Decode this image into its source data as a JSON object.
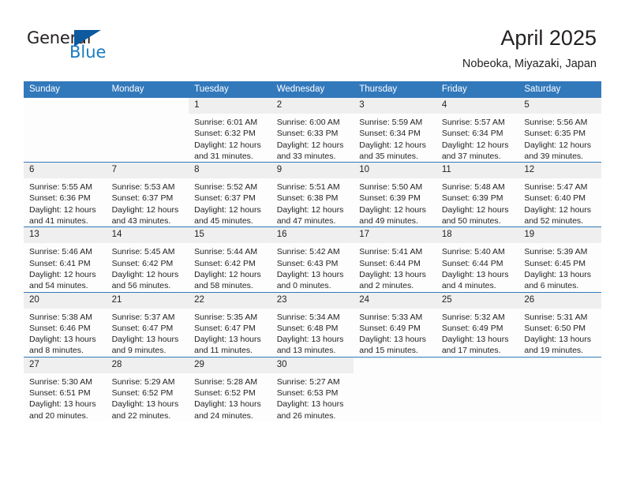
{
  "logo": {
    "word_one": "General",
    "word_two": "Blue",
    "triangle_icon": "triangle-icon"
  },
  "header": {
    "month_title": "April 2025",
    "location": "Nobeoka, Miyazaki, Japan"
  },
  "colors": {
    "header_blue": "#3279bc",
    "daynum_gray": "#efefef",
    "logo_blue": "#1a7bc0",
    "logo_triangle": "#0d5a9e",
    "text": "#231f20"
  },
  "calendar": {
    "weekday_headers": [
      "Sunday",
      "Monday",
      "Tuesday",
      "Wednesday",
      "Thursday",
      "Friday",
      "Saturday"
    ],
    "weeks": [
      [
        {
          "day": "",
          "empty": true
        },
        {
          "day": "",
          "empty": true
        },
        {
          "day": "1",
          "sunrise": "Sunrise: 6:01 AM",
          "sunset": "Sunset: 6:32 PM",
          "daylight": "Daylight: 12 hours and 31 minutes."
        },
        {
          "day": "2",
          "sunrise": "Sunrise: 6:00 AM",
          "sunset": "Sunset: 6:33 PM",
          "daylight": "Daylight: 12 hours and 33 minutes."
        },
        {
          "day": "3",
          "sunrise": "Sunrise: 5:59 AM",
          "sunset": "Sunset: 6:34 PM",
          "daylight": "Daylight: 12 hours and 35 minutes."
        },
        {
          "day": "4",
          "sunrise": "Sunrise: 5:57 AM",
          "sunset": "Sunset: 6:34 PM",
          "daylight": "Daylight: 12 hours and 37 minutes."
        },
        {
          "day": "5",
          "sunrise": "Sunrise: 5:56 AM",
          "sunset": "Sunset: 6:35 PM",
          "daylight": "Daylight: 12 hours and 39 minutes."
        }
      ],
      [
        {
          "day": "6",
          "sunrise": "Sunrise: 5:55 AM",
          "sunset": "Sunset: 6:36 PM",
          "daylight": "Daylight: 12 hours and 41 minutes."
        },
        {
          "day": "7",
          "sunrise": "Sunrise: 5:53 AM",
          "sunset": "Sunset: 6:37 PM",
          "daylight": "Daylight: 12 hours and 43 minutes."
        },
        {
          "day": "8",
          "sunrise": "Sunrise: 5:52 AM",
          "sunset": "Sunset: 6:37 PM",
          "daylight": "Daylight: 12 hours and 45 minutes."
        },
        {
          "day": "9",
          "sunrise": "Sunrise: 5:51 AM",
          "sunset": "Sunset: 6:38 PM",
          "daylight": "Daylight: 12 hours and 47 minutes."
        },
        {
          "day": "10",
          "sunrise": "Sunrise: 5:50 AM",
          "sunset": "Sunset: 6:39 PM",
          "daylight": "Daylight: 12 hours and 49 minutes."
        },
        {
          "day": "11",
          "sunrise": "Sunrise: 5:48 AM",
          "sunset": "Sunset: 6:39 PM",
          "daylight": "Daylight: 12 hours and 50 minutes."
        },
        {
          "day": "12",
          "sunrise": "Sunrise: 5:47 AM",
          "sunset": "Sunset: 6:40 PM",
          "daylight": "Daylight: 12 hours and 52 minutes."
        }
      ],
      [
        {
          "day": "13",
          "sunrise": "Sunrise: 5:46 AM",
          "sunset": "Sunset: 6:41 PM",
          "daylight": "Daylight: 12 hours and 54 minutes."
        },
        {
          "day": "14",
          "sunrise": "Sunrise: 5:45 AM",
          "sunset": "Sunset: 6:42 PM",
          "daylight": "Daylight: 12 hours and 56 minutes."
        },
        {
          "day": "15",
          "sunrise": "Sunrise: 5:44 AM",
          "sunset": "Sunset: 6:42 PM",
          "daylight": "Daylight: 12 hours and 58 minutes."
        },
        {
          "day": "16",
          "sunrise": "Sunrise: 5:42 AM",
          "sunset": "Sunset: 6:43 PM",
          "daylight": "Daylight: 13 hours and 0 minutes."
        },
        {
          "day": "17",
          "sunrise": "Sunrise: 5:41 AM",
          "sunset": "Sunset: 6:44 PM",
          "daylight": "Daylight: 13 hours and 2 minutes."
        },
        {
          "day": "18",
          "sunrise": "Sunrise: 5:40 AM",
          "sunset": "Sunset: 6:44 PM",
          "daylight": "Daylight: 13 hours and 4 minutes."
        },
        {
          "day": "19",
          "sunrise": "Sunrise: 5:39 AM",
          "sunset": "Sunset: 6:45 PM",
          "daylight": "Daylight: 13 hours and 6 minutes."
        }
      ],
      [
        {
          "day": "20",
          "sunrise": "Sunrise: 5:38 AM",
          "sunset": "Sunset: 6:46 PM",
          "daylight": "Daylight: 13 hours and 8 minutes."
        },
        {
          "day": "21",
          "sunrise": "Sunrise: 5:37 AM",
          "sunset": "Sunset: 6:47 PM",
          "daylight": "Daylight: 13 hours and 9 minutes."
        },
        {
          "day": "22",
          "sunrise": "Sunrise: 5:35 AM",
          "sunset": "Sunset: 6:47 PM",
          "daylight": "Daylight: 13 hours and 11 minutes."
        },
        {
          "day": "23",
          "sunrise": "Sunrise: 5:34 AM",
          "sunset": "Sunset: 6:48 PM",
          "daylight": "Daylight: 13 hours and 13 minutes."
        },
        {
          "day": "24",
          "sunrise": "Sunrise: 5:33 AM",
          "sunset": "Sunset: 6:49 PM",
          "daylight": "Daylight: 13 hours and 15 minutes."
        },
        {
          "day": "25",
          "sunrise": "Sunrise: 5:32 AM",
          "sunset": "Sunset: 6:49 PM",
          "daylight": "Daylight: 13 hours and 17 minutes."
        },
        {
          "day": "26",
          "sunrise": "Sunrise: 5:31 AM",
          "sunset": "Sunset: 6:50 PM",
          "daylight": "Daylight: 13 hours and 19 minutes."
        }
      ],
      [
        {
          "day": "27",
          "sunrise": "Sunrise: 5:30 AM",
          "sunset": "Sunset: 6:51 PM",
          "daylight": "Daylight: 13 hours and 20 minutes."
        },
        {
          "day": "28",
          "sunrise": "Sunrise: 5:29 AM",
          "sunset": "Sunset: 6:52 PM",
          "daylight": "Daylight: 13 hours and 22 minutes."
        },
        {
          "day": "29",
          "sunrise": "Sunrise: 5:28 AM",
          "sunset": "Sunset: 6:52 PM",
          "daylight": "Daylight: 13 hours and 24 minutes."
        },
        {
          "day": "30",
          "sunrise": "Sunrise: 5:27 AM",
          "sunset": "Sunset: 6:53 PM",
          "daylight": "Daylight: 13 hours and 26 minutes."
        },
        {
          "day": "",
          "empty": true
        },
        {
          "day": "",
          "empty": true
        },
        {
          "day": "",
          "empty": true
        }
      ]
    ]
  }
}
